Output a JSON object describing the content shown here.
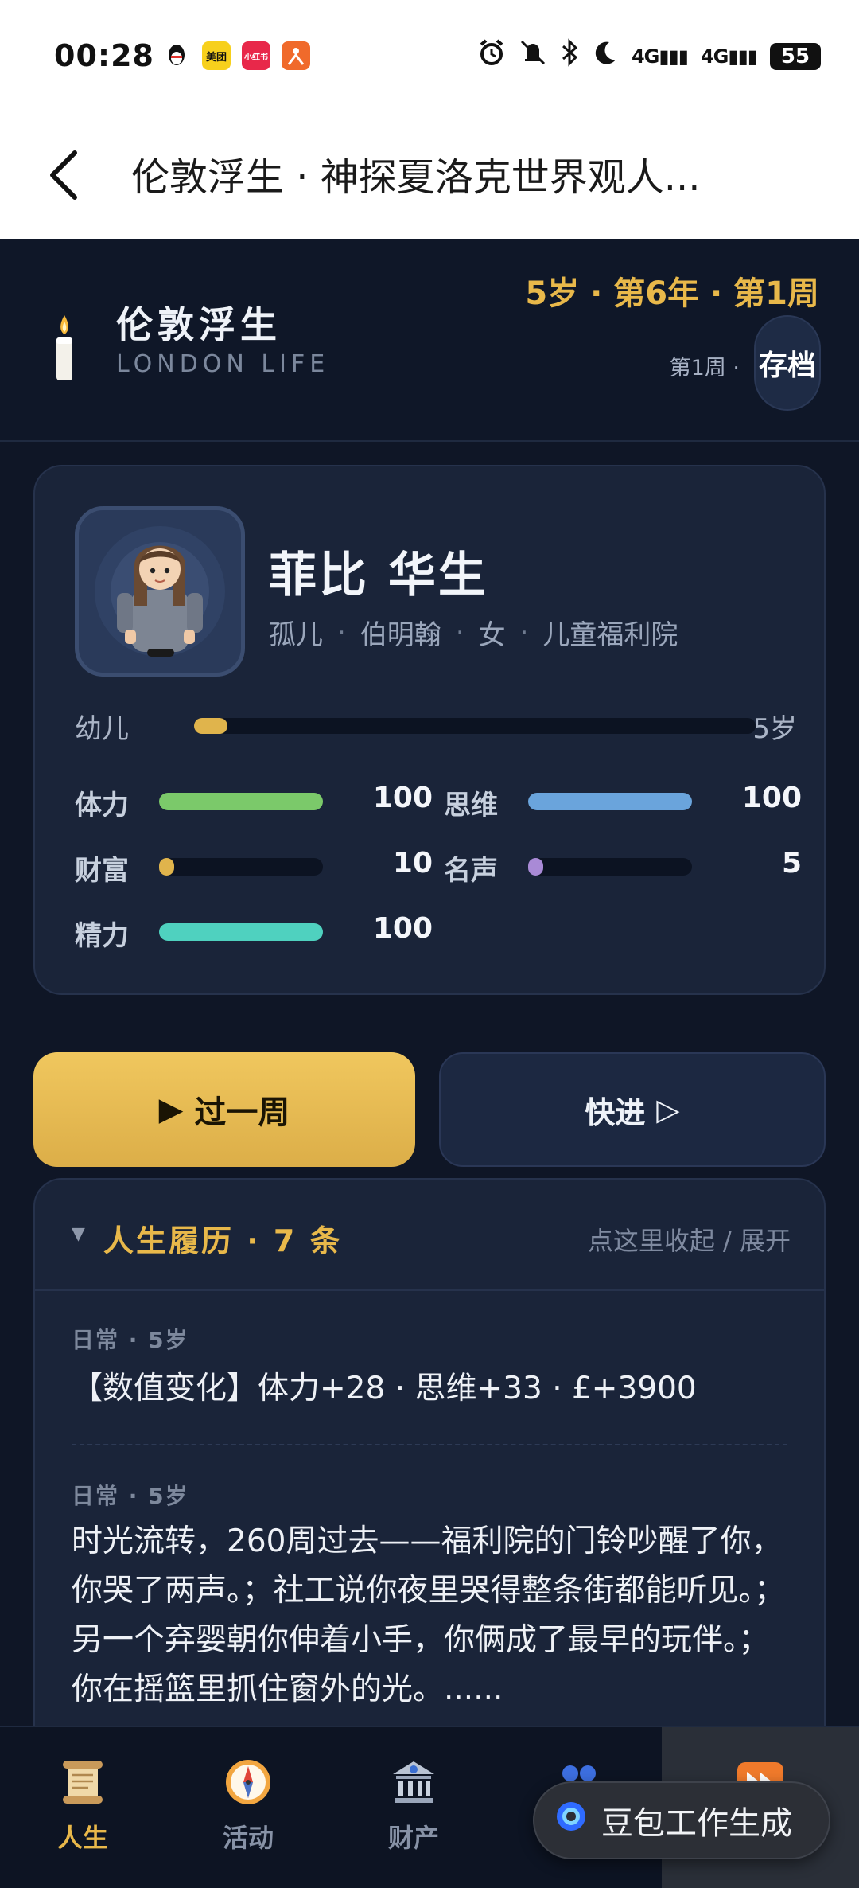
{
  "status_bar": {
    "time": "00:28",
    "notifications": [
      {
        "name": "qq-icon",
        "label": "",
        "color": "#111111"
      },
      {
        "name": "meituan-icon",
        "label": "美团",
        "color": "#f7d01c"
      },
      {
        "name": "xiaohongshu-icon",
        "label": "小红书",
        "color": "#e8284a"
      },
      {
        "name": "app-icon",
        "label": "",
        "color": "#f06a2b"
      }
    ],
    "signal_a": "4G",
    "signal_b": "4G",
    "battery": "55"
  },
  "nav": {
    "title": "伦敦浮生 · 神探夏洛克世界观人..."
  },
  "game_header": {
    "title": "伦敦浮生",
    "subtitle": "LONDON LIFE",
    "age_line": "5岁 · 第6年 · 第1周",
    "week_small": "第1周 ·",
    "save_label": "存档"
  },
  "profile": {
    "name": "菲比 华生",
    "tags": [
      "孤儿",
      "伯明翰",
      "女",
      "儿童福利院"
    ],
    "stage_label": "幼儿",
    "stage_age": "5岁",
    "stage_progress": 0.06,
    "stats": [
      {
        "key": "stamina",
        "label": "体力",
        "value": "100",
        "progress": 1.0,
        "color": "#7bc96a"
      },
      {
        "key": "thinking",
        "label": "思维",
        "value": "100",
        "progress": 1.0,
        "color": "#6aa4dc"
      },
      {
        "key": "wealth",
        "label": "财富",
        "value": "10",
        "progress": 0.05,
        "color": "#e0b44c"
      },
      {
        "key": "fame",
        "label": "名声",
        "value": "5",
        "progress": 0.03,
        "color": "#a98ad6"
      },
      {
        "key": "energy",
        "label": "精力",
        "value": "100",
        "progress": 1.0,
        "color": "#4fd1bf"
      }
    ]
  },
  "actions": {
    "pass_week_icon": "▶",
    "pass_week_label": "过一周",
    "fast_forward_label": "快进",
    "fast_forward_icon": "▷"
  },
  "history": {
    "caret": "▼",
    "title": "人生履历 · 7 条",
    "toggle": "点这里收起 / 展开",
    "entries": [
      {
        "meta": "日常 · 5岁",
        "text": "【数值变化】体力+28 · 思维+33 · £+3900"
      },
      {
        "meta": "日常 · 5岁",
        "text": "时光流转，260周过去——福利院的门铃吵醒了你，你哭了两声。；社工说你夜里哭得整条街都能听见。；另一个弃婴朝你伸着小手，你俩成了最早的玩伴。；你在摇篮里抓住窗外的光。......"
      }
    ]
  },
  "tabbar": {
    "tabs": [
      {
        "label": "人生",
        "icon": "scroll-icon"
      },
      {
        "label": "活动",
        "icon": "compass-icon"
      },
      {
        "label": "财产",
        "icon": "bank-icon"
      },
      {
        "label": "",
        "icon": "people-icon"
      },
      {
        "label": "",
        "icon": "fast-forward-icon"
      }
    ]
  },
  "floating": {
    "label": "豆包工作生成"
  }
}
